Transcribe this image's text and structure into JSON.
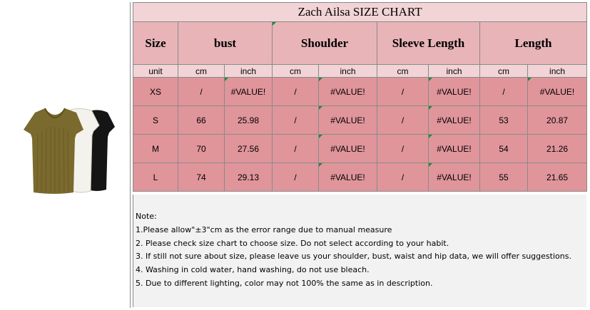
{
  "title": "Zach Ailsa  SIZE CHART",
  "headers": [
    "Size",
    "bust",
    "Shoulder",
    "Sleeve Length",
    "Length"
  ],
  "units": [
    "unit",
    "cm",
    "inch",
    "cm",
    "inch",
    "cm",
    "inch",
    "cm",
    "inch"
  ],
  "rows": [
    [
      "XS",
      "/",
      "#VALUE!",
      "/",
      "#VALUE!",
      "/",
      "#VALUE!",
      "/",
      "#VALUE!"
    ],
    [
      "S",
      "66",
      "25.98",
      "/",
      "#VALUE!",
      "/",
      "#VALUE!",
      "53",
      "20.87"
    ],
    [
      "M",
      "70",
      "27.56",
      "/",
      "#VALUE!",
      "/",
      "#VALUE!",
      "54",
      "21.26"
    ],
    [
      "L",
      "74",
      "29.13",
      "/",
      "#VALUE!",
      "/",
      "#VALUE!",
      "55",
      "21.65"
    ]
  ],
  "notes": [
    "Note:",
    "1.Please allow\"±3\"cm as the error range due to manual measure",
    "2. Please check size chart to choose size. Do not select according to your habit.",
    "3. If still not sure about size, please leave us your shoulder, bust, waist and hip data, we will offer suggestions.",
    "4. Washing in cold water, hand washing, do not use bleach.",
    "5. Due to different lighting, color may not 100% the same as in description."
  ],
  "colors": {
    "title_bg": "#f2d4d6",
    "header_bg": "#e8b4b8",
    "data_bg": "#e0959b",
    "notes_bg": "#f2f2f2",
    "grid_line": "#8a8a8a",
    "product_colors": [
      "#7a6a2e",
      "#f4f2ec",
      "#151515"
    ]
  }
}
